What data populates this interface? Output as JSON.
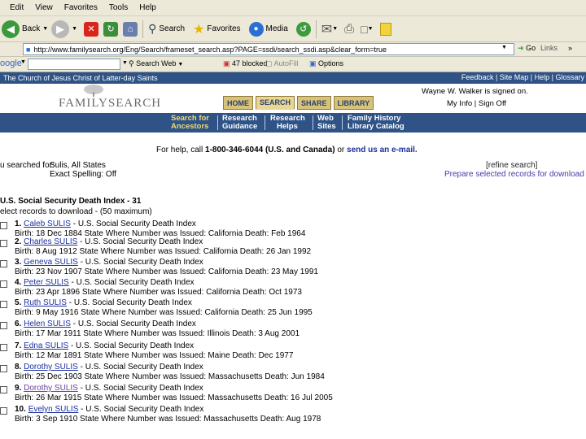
{
  "menu": [
    "Edit",
    "View",
    "Favorites",
    "Tools",
    "Help"
  ],
  "toolbar": {
    "back": "Back",
    "search": "Search",
    "favorites": "Favorites",
    "media": "Media"
  },
  "address": {
    "url": "http://www.familysearch.org/Eng/Search/frameset_search.asp?PAGE=ssdi/search_ssdi.asp&clear_form=true",
    "go": "Go",
    "links": "Links"
  },
  "googlebar": {
    "brand": "oogle",
    "search_web": "Search Web",
    "blocked": "47 blocked",
    "autofill": "AutoFill",
    "options": "Options"
  },
  "lds": {
    "title": "The Church of Jesus Christ of Latter-day Saints",
    "right": "Feedback | Site Map | Help | Glossary"
  },
  "fs": {
    "logo": "FAMILYSEARCH",
    "tabs": [
      "HOME",
      "SEARCH",
      "SHARE",
      "LIBRARY"
    ],
    "welcome": "Wayne W. Walker is signed on.",
    "myinfo": "My Info | Sign Off",
    "subnav": [
      {
        "l1": "Search for",
        "l2": "Ancestors",
        "active": true
      },
      {
        "l1": "Research",
        "l2": "Guidance"
      },
      {
        "l1": "Research",
        "l2": "Helps"
      },
      {
        "l1": "Web",
        "l2": "Sites"
      },
      {
        "l1": "Family History",
        "l2": "Library Catalog"
      }
    ]
  },
  "help": {
    "pre": "For help, call",
    "phone": "1-800-346-6044 (U.S. and Canada)",
    "mid": "or",
    "link": "send us an e-mail."
  },
  "searched": {
    "label": "u searched for:",
    "name": "Sulis, All States",
    "spelling": "Exact Spelling: Off"
  },
  "refine": "[refine search]",
  "prepare": "Prepare selected records for download",
  "results": {
    "title": "U.S. Social Security Death Index - 31",
    "select": "elect records to download - (50 maximum)",
    "records": [
      {
        "num": "1.",
        "name": "Caleb SULIS",
        "src": " - U.S. Social Security Death Index",
        "detail": "Birth: 18 Dec 1884   State Where Number was Issued: California   Death: Feb 1964"
      },
      {
        "num": "2.",
        "name": "Charles SULIS",
        "src": " - U.S. Social Security Death Index",
        "detail": "Birth: 8 Aug 1912   State Where Number was Issued: California   Death: 26 Jan 1992"
      },
      {
        "num": "3.",
        "name": "Geneva SULIS",
        "src": " - U.S. Social Security Death Index",
        "detail": "Birth: 23 Nov 1907   State Where Number was Issued: California   Death: 23 May 1991"
      },
      {
        "num": "4.",
        "name": "Peter SULIS",
        "src": " - U.S. Social Security Death Index",
        "detail": "Birth: 23 Apr 1896   State Where Number was Issued: California   Death: Oct 1973"
      },
      {
        "num": "5.",
        "name": "Ruth SULIS",
        "src": " - U.S. Social Security Death Index",
        "detail": "Birth: 9 May 1916   State Where Number was Issued: California   Death: 25 Jun 1995"
      },
      {
        "num": "6.",
        "name": "Helen SULIS",
        "src": " - U.S. Social Security Death Index",
        "detail": "Birth: 17 Mar 1911   State Where Number was Issued: Illinois   Death: 3 Aug 2001"
      },
      {
        "num": "7.",
        "name": "Edna SULIS",
        "src": " - U.S. Social Security Death Index",
        "detail": "Birth: 12 Mar 1891   State Where Number was Issued: Maine   Death: Dec 1977"
      },
      {
        "num": "8.",
        "name": "Dorothy SULIS",
        "src": " - U.S. Social Security Death Index",
        "detail": "Birth: 25 Dec 1903   State Where Number was Issued: Massachusetts   Death: Jun 1984"
      },
      {
        "num": "9.",
        "name": "Dorothy SULIS",
        "src": " - U.S. Social Security Death Index",
        "detail": "Birth: 26 Mar 1915   State Where Number was Issued: Massachusetts   Death: 16 Jul 2005"
      },
      {
        "num": "10.",
        "name": "Evelyn SULIS",
        "src": " - U.S. Social Security Death Index",
        "detail": "Birth: 3 Sep 1910   State Where Number was Issued: Massachusetts   Death: Aug 1978"
      }
    ]
  }
}
